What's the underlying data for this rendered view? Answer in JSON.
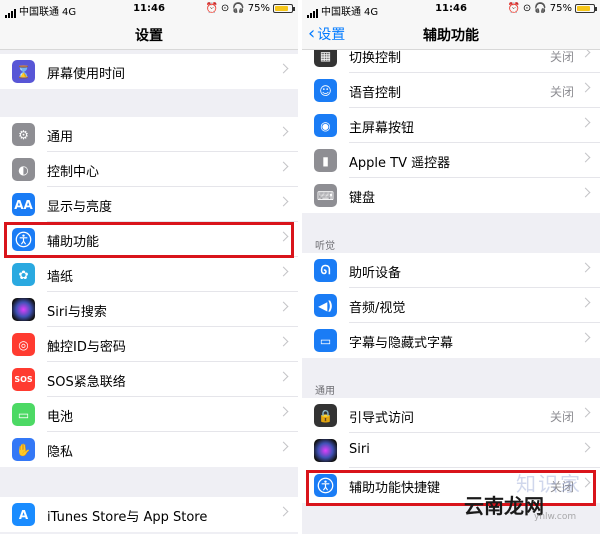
{
  "status_left": {
    "carrier": "中国联通",
    "network": "4G",
    "time": "11:46",
    "battery": "75%"
  },
  "status_right": {
    "carrier": "中国联通",
    "network": "4G",
    "time": "11:46",
    "battery": "75%"
  },
  "left": {
    "title": "设置",
    "items": [
      {
        "label": "屏幕使用时间",
        "icon": "hourglass-icon",
        "color": "#5856d6"
      },
      {
        "label": "通用",
        "icon": "gear-icon",
        "color": "#8e8e93"
      },
      {
        "label": "控制中心",
        "icon": "toggles-icon",
        "color": "#8e8e93"
      },
      {
        "label": "显示与亮度",
        "icon": "text-size-icon",
        "color": "#1a7cf5"
      },
      {
        "label": "辅助功能",
        "icon": "accessibility-icon",
        "color": "#1a7cf5"
      },
      {
        "label": "墙纸",
        "icon": "flower-icon",
        "color": "#2aa9e0"
      },
      {
        "label": "Siri与搜索",
        "icon": "siri-icon",
        "color": "#222222"
      },
      {
        "label": "触控ID与密码",
        "icon": "fingerprint-icon",
        "color": "#ff3b30"
      },
      {
        "label": "SOS紧急联络",
        "icon": "sos-icon",
        "color": "#ff3b30"
      },
      {
        "label": "电池",
        "icon": "battery-icon",
        "color": "#4cd964"
      },
      {
        "label": "隐私",
        "icon": "hand-icon",
        "color": "#3478f6"
      },
      {
        "label": "iTunes Store与 App Store",
        "icon": "app-store-icon",
        "color": "#1a8cff"
      }
    ]
  },
  "right": {
    "title": "辅助功能",
    "back_label": "设置",
    "items": [
      {
        "label": "切换控制",
        "value": "关闭",
        "icon": "grid-icon",
        "color": "#333333"
      },
      {
        "label": "语音控制",
        "value": "关闭",
        "icon": "voice-control-icon",
        "color": "#1a7cf5"
      },
      {
        "label": "主屏幕按钮",
        "value": "",
        "icon": "home-button-icon",
        "color": "#1a7cf5"
      },
      {
        "label": "Apple TV 遥控器",
        "value": "",
        "icon": "remote-icon",
        "color": "#8e8e93"
      },
      {
        "label": "键盘",
        "value": "",
        "icon": "keyboard-icon",
        "color": "#8e8e93"
      },
      {
        "label": "助听设备",
        "value": "",
        "icon": "ear-icon",
        "color": "#1a7cf5"
      },
      {
        "label": "音频/视觉",
        "value": "",
        "icon": "speaker-icon",
        "color": "#1a7cf5"
      },
      {
        "label": "字幕与隐藏式字幕",
        "value": "",
        "icon": "captions-icon",
        "color": "#1a7cf5"
      },
      {
        "label": "引导式访问",
        "value": "关闭",
        "icon": "lock-icon",
        "color": "#333333"
      },
      {
        "label": "Siri",
        "value": "",
        "icon": "siri-icon",
        "color": "#222222"
      },
      {
        "label": "辅助功能快捷键",
        "value": "关闭",
        "icon": "accessibility-icon",
        "color": "#1a7cf5"
      }
    ],
    "section_hearing": "听觉",
    "section_general": "通用"
  },
  "watermark": {
    "text1": "知识家",
    "text2": "云南龙网",
    "text3": "ynlw.com"
  }
}
